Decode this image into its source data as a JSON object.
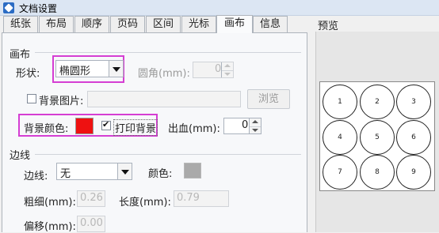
{
  "window": {
    "title": "文档设置"
  },
  "tabs": [
    "纸张",
    "布局",
    "顺序",
    "页码",
    "区间",
    "光标",
    "画布",
    "信息"
  ],
  "active_tab": "画布",
  "canvas_group": {
    "title": "画布",
    "shape_label": "形状:",
    "shape_value": "椭圆形",
    "corner_label": "圆角(mm):",
    "corner_value": "0",
    "bg_image_label": "背景图片:",
    "browse_label": "浏览",
    "bg_color_label": "背景颜色:",
    "bg_color": "#ee1111",
    "print_bg_label": "打印背景",
    "print_bg_checked": true,
    "bleed_label": "出血(mm):",
    "bleed_value": "0"
  },
  "border_group": {
    "title": "边线",
    "line_label": "边线:",
    "line_value": "无",
    "color_label": "颜色:",
    "color_value": "#aaaaaa",
    "thickness_label": "粗细(mm):",
    "thickness_value": "0.26",
    "length_label": "长度(mm):",
    "length_value": "0.79",
    "offset_label": "偏移(mm):",
    "offset_value": "0.00"
  },
  "preview": {
    "title": "预览",
    "labels": [
      "1",
      "2",
      "3",
      "4",
      "5",
      "6",
      "7",
      "8",
      "9"
    ]
  },
  "colors": {
    "highlight": "#d53ed3",
    "accent": "#2b6cc4"
  }
}
